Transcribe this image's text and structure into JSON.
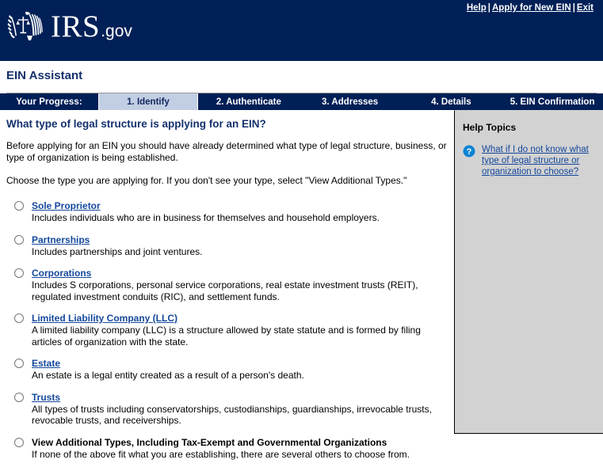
{
  "header": {
    "logo_alt": "IRS eagle seal",
    "brand_primary": "IRS",
    "brand_secondary": ".gov",
    "utility_links": [
      {
        "label": "Help"
      },
      {
        "label": "Apply for New EIN"
      },
      {
        "label": "Exit"
      }
    ],
    "separator": "|"
  },
  "app": {
    "title": "EIN Assistant"
  },
  "progress": {
    "label": "Your Progress:",
    "steps": [
      {
        "label": "1. Identify",
        "current": true
      },
      {
        "label": "2. Authenticate",
        "current": false
      },
      {
        "label": "3. Addresses",
        "current": false
      },
      {
        "label": "4. Details",
        "current": false
      },
      {
        "label": "5. EIN Confirmation",
        "current": false
      }
    ]
  },
  "main": {
    "heading": "What type of legal structure is applying for an EIN?",
    "paragraph_1": "Before applying for an EIN you should have already determined what type of legal structure, business, or type of organization is being established.",
    "paragraph_2": "Choose the type you are applying for. If you don't see your type, select \"View Additional Types.\"",
    "options": [
      {
        "label": "Sole Proprietor",
        "description": "Includes individuals who are in business for themselves and household employers.",
        "is_link": true,
        "selected": false
      },
      {
        "label": "Partnerships",
        "description": "Includes partnerships and joint ventures.",
        "is_link": true,
        "selected": false
      },
      {
        "label": "Corporations",
        "description": "Includes S corporations, personal service corporations, real estate investment trusts (REIT), regulated investment conduits (RIC), and settlement funds.",
        "is_link": true,
        "selected": false
      },
      {
        "label": "Limited Liability Company (LLC)",
        "description": "A limited liability company (LLC) is a structure allowed by state statute and is formed by filing articles of organization with the state.",
        "is_link": true,
        "selected": false
      },
      {
        "label": "Estate",
        "description": "An estate is a legal entity created as a result of a person's death.",
        "is_link": true,
        "selected": false
      },
      {
        "label": "Trusts",
        "description": "All types of trusts including conservatorships, custodianships, guardianships, irrevocable trusts, revocable trusts, and receiverships.",
        "is_link": true,
        "selected": false
      },
      {
        "label": "View Additional Types, Including Tax-Exempt and Governmental Organizations",
        "description": "If none of the above fit what you are establishing, there are several others to choose from.",
        "is_link": false,
        "selected": false
      }
    ]
  },
  "help": {
    "title": "Help Topics",
    "icon": "question-mark-circle-icon",
    "items": [
      {
        "label": "What if I do not know what type of legal structure or organization to choose?"
      }
    ]
  },
  "colors": {
    "header_navy": "#002057",
    "progress_navy": "#001f56",
    "current_step_bg": "#c2cee3",
    "link_blue": "#14489c",
    "heading_blue": "#13316d",
    "help_panel_bg": "#d2d2d2",
    "help_icon_blue": "#0b84d4"
  }
}
